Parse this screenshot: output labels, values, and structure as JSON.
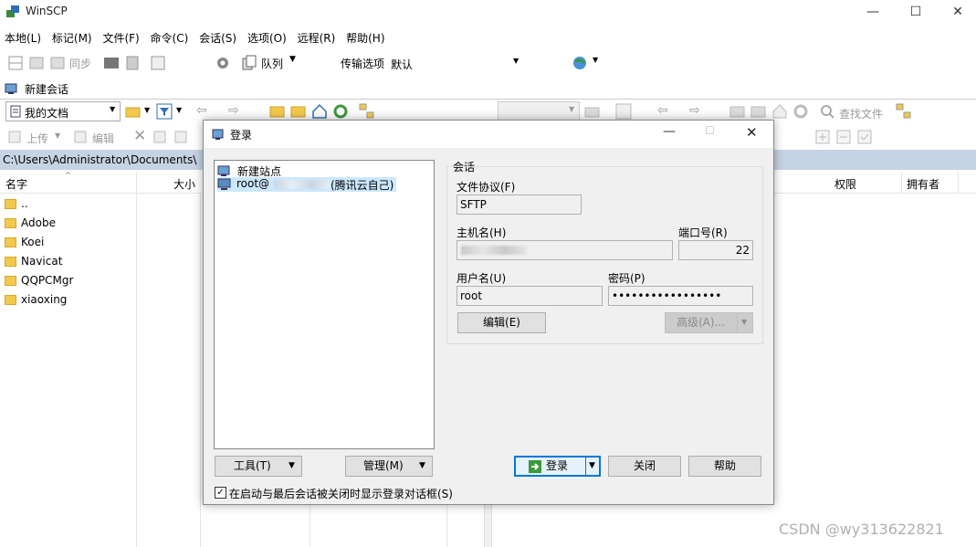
{
  "window": {
    "title": "WinSCP",
    "min": "—",
    "max": "☐",
    "close": "✕"
  },
  "menu": [
    "本地(L)",
    "标记(M)",
    "文件(F)",
    "命令(C)",
    "会话(S)",
    "选项(O)",
    "远程(R)",
    "帮助(H)"
  ],
  "toolbar1": {
    "sync": "同步",
    "queue": "队列",
    "transfer_label": "传输选项",
    "transfer_value": "默认"
  },
  "session_tab": "新建会话",
  "local": {
    "drive": "我的文档",
    "upload": "上传",
    "edit": "编辑",
    "path": "C:\\Users\\Administrator\\Documents\\",
    "col_name": "名字",
    "col_size": "大小",
    "files": [
      "..",
      "Adobe",
      "Koei",
      "Navicat",
      "QQPCMgr",
      "xiaoxing"
    ]
  },
  "remote": {
    "find": "查找文件",
    "col_perm": "权限",
    "col_owner": "拥有者"
  },
  "dialog": {
    "title": "登录",
    "tree": {
      "new_site": "新建站点",
      "saved_prefix": "root@",
      "saved_suffix": "(腾讯云自己)"
    },
    "group_label": "会话",
    "protocol_label": "文件协议(F)",
    "protocol_value": "SFTP",
    "host_label": "主机名(H)",
    "port_label": "端口号(R)",
    "port_value": "22",
    "user_label": "用户名(U)",
    "user_value": "root",
    "pass_label": "密码(P)",
    "pass_value": "•••••••••••••••••",
    "edit_btn": "编辑(E)",
    "advanced_btn": "高级(A)...",
    "tools_btn": "工具(T)",
    "manage_btn": "管理(M)",
    "login_btn": "登录",
    "close_btn": "关闭",
    "help_btn": "帮助",
    "checkbox_label": "在启动与最后会话被关闭时显示登录对话框(S)"
  },
  "watermark": "CSDN @wy313622821"
}
